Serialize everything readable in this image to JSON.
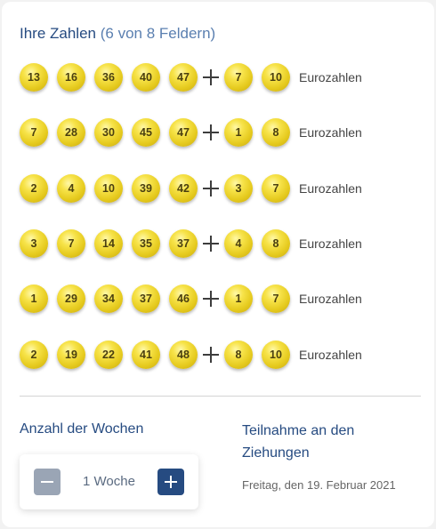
{
  "header": {
    "title": "Ihre Zahlen",
    "subtitle": "(6 von 8 Feldern)"
  },
  "euro_label": "Eurozahlen",
  "colors": {
    "accent": "#264b81",
    "ball": "#f2dc3a"
  },
  "rows": [
    {
      "main": [
        "13",
        "16",
        "36",
        "40",
        "47"
      ],
      "euro": [
        "7",
        "10"
      ]
    },
    {
      "main": [
        "7",
        "28",
        "30",
        "45",
        "47"
      ],
      "euro": [
        "1",
        "8"
      ]
    },
    {
      "main": [
        "2",
        "4",
        "10",
        "39",
        "42"
      ],
      "euro": [
        "3",
        "7"
      ]
    },
    {
      "main": [
        "3",
        "7",
        "14",
        "35",
        "37"
      ],
      "euro": [
        "4",
        "8"
      ]
    },
    {
      "main": [
        "1",
        "29",
        "34",
        "37",
        "46"
      ],
      "euro": [
        "1",
        "7"
      ]
    },
    {
      "main": [
        "2",
        "19",
        "22",
        "41",
        "48"
      ],
      "euro": [
        "8",
        "10"
      ]
    }
  ],
  "weeks": {
    "heading": "Anzahl der Wochen",
    "value": "1 Woche",
    "minus_icon": "minus-icon",
    "plus_icon": "plus-icon"
  },
  "draws": {
    "heading": "Teilnahme an den Ziehungen",
    "date": "Freitag, den 19. Februar 2021"
  }
}
